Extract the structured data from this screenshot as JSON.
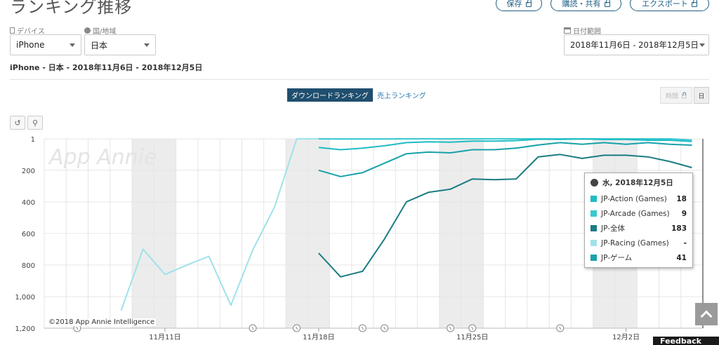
{
  "header": {
    "title": "ランキング推移",
    "buttons": [
      "保存",
      "購読・共有",
      "エクスポート"
    ]
  },
  "filters": {
    "device_label": "デバイス",
    "device_value": "iPhone",
    "country_label": "国/地域",
    "country_value": "日本",
    "date_label": "日付範囲",
    "date_value": "2018年11月6日 - 2018年12月5日"
  },
  "subtitle": "iPhone - 日本 - 2018年11月6日 - 2018年12月5日",
  "tabs": {
    "active": "ダウンロードランキング",
    "other": "売上ランキング"
  },
  "granularity": {
    "hourly": "時間",
    "daily": "日"
  },
  "watermark": "App Annie",
  "copyright": "©2018 App Annie Intelligence",
  "tooltip": {
    "date": "水, 2018年12月5日",
    "rows": [
      {
        "name": "JP-Action (Games)",
        "value": "18",
        "color": "#1fbcc4"
      },
      {
        "name": "JP-Arcade (Games)",
        "value": "9",
        "color": "#38c9d0"
      },
      {
        "name": "JP-全体",
        "value": "183",
        "color": "#1a7c82"
      },
      {
        "name": "JP-Racing (Games)",
        "value": "-",
        "color": "#9fe2ea"
      },
      {
        "name": "JP-ゲーム",
        "value": "41",
        "color": "#17a2aa"
      }
    ]
  },
  "feedback": "Feedback",
  "chart_data": {
    "type": "line",
    "y_reversed": true,
    "ylim": [
      1,
      1200
    ],
    "y_ticks": [
      "1",
      "200",
      "400",
      "600",
      "800",
      "1,000",
      "1,200"
    ],
    "x_tick_labels": [
      "11月11日",
      "11月18日",
      "11月25日",
      "12月2日"
    ],
    "x_dates": [
      "11-06",
      "11-07",
      "11-08",
      "11-09",
      "11-10",
      "11-11",
      "11-12",
      "11-13",
      "11-14",
      "11-15",
      "11-16",
      "11-17",
      "11-18",
      "11-19",
      "11-20",
      "11-21",
      "11-22",
      "11-23",
      "11-24",
      "11-25",
      "11-26",
      "11-27",
      "11-28",
      "11-29",
      "11-30",
      "12-01",
      "12-02",
      "12-03",
      "12-04",
      "12-05"
    ],
    "series": [
      {
        "name": "JP-Racing (Games)",
        "color": "#9fe2ea",
        "values": [
          null,
          null,
          null,
          1090,
          700,
          860,
          800,
          745,
          1055,
          705,
          430,
          1,
          1,
          1,
          1,
          1,
          1,
          1,
          1,
          1,
          1,
          1,
          1,
          1,
          1,
          1,
          1,
          1,
          1,
          null
        ]
      },
      {
        "name": "JP-Arcade (Games)",
        "color": "#38c9d0",
        "values": [
          null,
          null,
          null,
          null,
          null,
          null,
          null,
          null,
          null,
          null,
          null,
          null,
          1,
          2,
          2,
          2,
          1,
          1,
          1,
          1,
          1,
          1,
          1,
          1,
          1,
          1,
          1,
          1,
          1,
          9
        ]
      },
      {
        "name": "JP-Action (Games)",
        "color": "#1fbcc4",
        "values": [
          null,
          null,
          null,
          null,
          null,
          null,
          null,
          null,
          null,
          null,
          null,
          null,
          55,
          70,
          60,
          45,
          25,
          20,
          22,
          15,
          15,
          12,
          3,
          4,
          2,
          5,
          5,
          10,
          10,
          18
        ]
      },
      {
        "name": "JP-ゲーム",
        "color": "#17a2aa",
        "values": [
          null,
          null,
          null,
          null,
          null,
          null,
          null,
          null,
          null,
          null,
          null,
          null,
          200,
          240,
          215,
          155,
          95,
          85,
          90,
          70,
          70,
          60,
          40,
          25,
          35,
          25,
          35,
          25,
          35,
          41
        ]
      },
      {
        "name": "JP-全体",
        "color": "#1a7c82",
        "values": [
          null,
          null,
          null,
          null,
          null,
          null,
          null,
          null,
          null,
          null,
          null,
          null,
          725,
          875,
          840,
          635,
          400,
          340,
          320,
          255,
          260,
          255,
          115,
          100,
          125,
          105,
          105,
          115,
          145,
          183
        ]
      }
    ]
  }
}
